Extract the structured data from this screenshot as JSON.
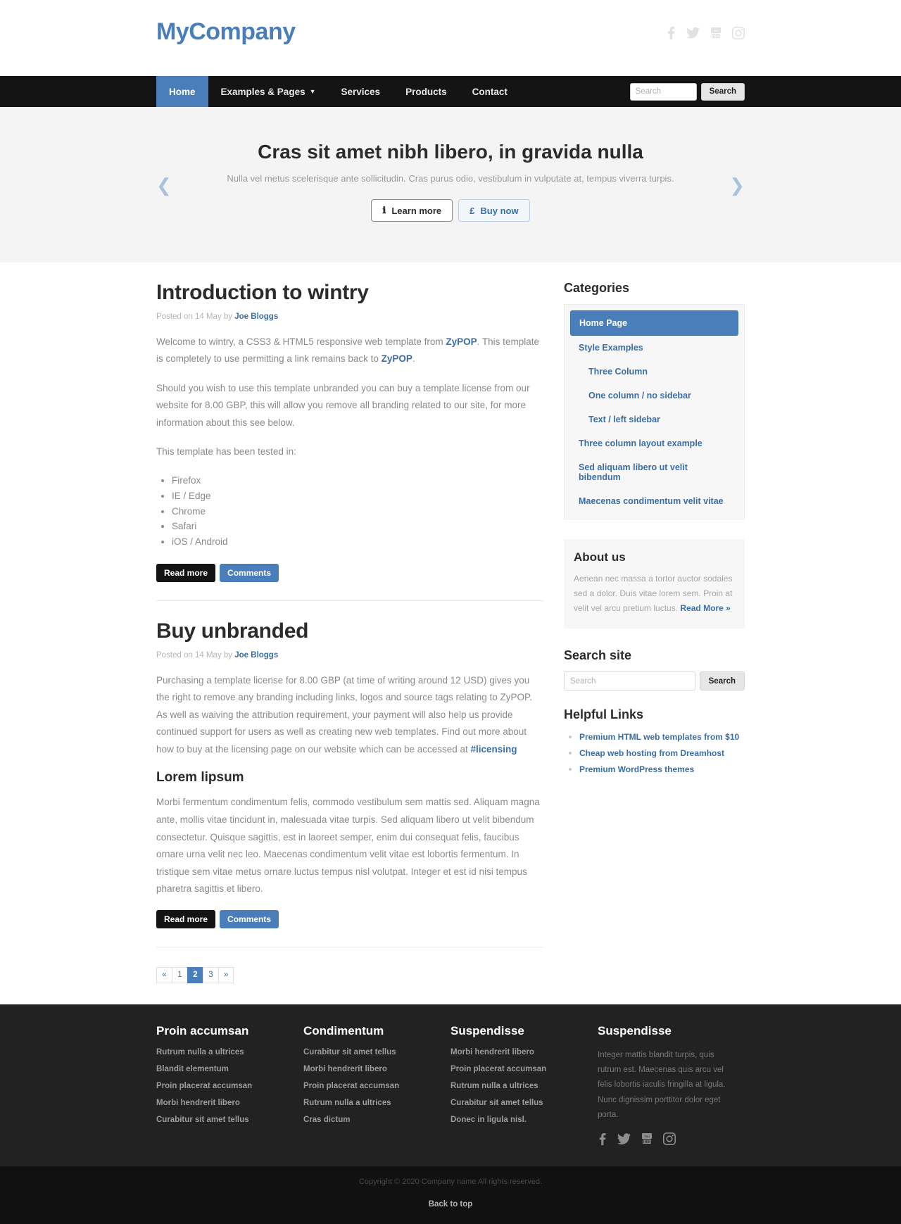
{
  "header": {
    "brand": "MyCompany",
    "social": [
      "facebook-icon",
      "twitter-icon",
      "youtube-icon",
      "instagram-icon"
    ]
  },
  "nav": {
    "items": [
      {
        "label": "Home",
        "active": true,
        "caret": false
      },
      {
        "label": "Examples & Pages",
        "active": false,
        "caret": true
      },
      {
        "label": "Services",
        "active": false,
        "caret": false
      },
      {
        "label": "Products",
        "active": false,
        "caret": false
      },
      {
        "label": "Contact",
        "active": false,
        "caret": false
      }
    ],
    "search_placeholder": "Search",
    "search_value": "",
    "search_button": "Search"
  },
  "hero": {
    "title": "Cras sit amet nibh libero, in gravida nulla",
    "subtitle": "Nulla vel metus scelerisque ante sollicitudin. Cras purus odio, vestibulum in vulputate at, tempus viverra turpis.",
    "btn_learn": "Learn more",
    "btn_learn_icon": "info-icon",
    "btn_buy": "Buy now",
    "btn_buy_icon": "pound-icon",
    "prev_icon": "chevron-left-icon",
    "next_icon": "chevron-right-icon"
  },
  "posts": [
    {
      "title": "Introduction to wintry",
      "meta_prefix": "Posted on 14 May by",
      "author": "Joe Bloggs",
      "p1_a": "Welcome to wintry, a CSS3 & HTML5 responsive web template from ",
      "p1_link1": "ZyPOP",
      "p1_b": ". This template is completely to use permitting a link remains back to ",
      "p1_link2": "ZyPOP",
      "p1_c": ".",
      "p2": "Should you wish to use this template unbranded you can buy a template license from our website for 8.00 GBP, this will allow you remove all branding related to our site, for more information about this see below.",
      "p3": "This template has been tested in:",
      "tested": [
        "Firefox",
        "IE / Edge",
        "Chrome",
        "Safari",
        "iOS / Android"
      ],
      "btn_read": "Read more",
      "btn_comments": "Comments"
    },
    {
      "title": "Buy unbranded",
      "meta_prefix": "Posted on 14 May by",
      "author": "Joe Bloggs",
      "p1_a": "Purchasing a template license for 8.00 GBP (at time of writing around 12 USD) gives you the right to remove any branding including links, logos and source tags relating to ZyPOP. As well as waiving the attribution requirement, your payment will also help us provide continued support for users as well as creating new web templates. Find out more about how to buy at the licensing page on our website which can be accessed at ",
      "p1_link1": "#licensing",
      "sub_head": "Lorem lipsum",
      "p2": "Morbi fermentum condimentum felis, commodo vestibulum sem mattis sed. Aliquam magna ante, mollis vitae tincidunt in, malesuada vitae turpis. Sed aliquam libero ut velit bibendum consectetur. Quisque sagittis, est in laoreet semper, enim dui consequat felis, faucibus ornare urna velit nec leo. Maecenas condimentum velit vitae est lobortis fermentum. In tristique sem vitae metus ornare luctus tempus nisl volutpat. Integer et est id nisi tempus pharetra sagittis et libero.",
      "btn_read": "Read more",
      "btn_comments": "Comments"
    }
  ],
  "pagination": [
    {
      "label": "«",
      "active": false
    },
    {
      "label": "1",
      "active": false
    },
    {
      "label": "2",
      "active": true
    },
    {
      "label": "3",
      "active": false
    },
    {
      "label": "»",
      "active": false
    }
  ],
  "sidebar": {
    "categories_title": "Categories",
    "categories": [
      {
        "label": "Home Page",
        "active": true,
        "indent": false
      },
      {
        "label": "Style Examples",
        "active": false,
        "indent": false
      },
      {
        "label": "Three Column",
        "active": false,
        "indent": true
      },
      {
        "label": "One column / no sidebar",
        "active": false,
        "indent": true
      },
      {
        "label": "Text / left sidebar",
        "active": false,
        "indent": true
      },
      {
        "label": "Three column layout example",
        "active": false,
        "indent": false
      },
      {
        "label": "Sed aliquam libero ut velit bibendum",
        "active": false,
        "indent": false
      },
      {
        "label": "Maecenas condimentum velit vitae",
        "active": false,
        "indent": false
      }
    ],
    "about_title": "About us",
    "about_text": "Aenean nec massa a tortor auctor sodales sed a dolor. Duis vitae lorem sem. Proin at velit vel arcu pretium luctus. ",
    "about_link": "Read More »",
    "search_title": "Search site",
    "search_placeholder": "Search",
    "search_value": "",
    "search_button": "Search",
    "helpful_title": "Helpful Links",
    "helpful_links": [
      "Premium HTML web templates from $10",
      "Cheap web hosting from Dreamhost",
      "Premium WordPress themes"
    ]
  },
  "footer": {
    "columns": [
      {
        "title": "Proin accumsan",
        "links": [
          "Rutrum nulla a ultrices",
          "Blandit elementum",
          "Proin placerat accumsan",
          "Morbi hendrerit libero",
          "Curabitur sit amet tellus"
        ],
        "text": null
      },
      {
        "title": "Condimentum",
        "links": [
          "Curabitur sit amet tellus",
          "Morbi hendrerit libero",
          "Proin placerat accumsan",
          "Rutrum nulla a ultrices",
          "Cras dictum"
        ],
        "text": null
      },
      {
        "title": "Suspendisse",
        "links": [
          "Morbi hendrerit libero",
          "Proin placerat accumsan",
          "Rutrum nulla a ultrices",
          "Curabitur sit amet tellus",
          "Donec in ligula nisl."
        ],
        "text": null
      },
      {
        "title": "Suspendisse",
        "links": [],
        "text": "Integer mattis blandit turpis, quis rutrum est. Maecenas quis arcu vel felis lobortis iaculis fringilla at ligula. Nunc dignissim porttitor dolor eget porta."
      }
    ],
    "social": [
      "facebook-icon",
      "twitter-icon",
      "youtube-icon",
      "instagram-icon"
    ],
    "copyright": "Copyright © 2020 Company name All rights reserved.",
    "back_to_top": "Back to top"
  }
}
